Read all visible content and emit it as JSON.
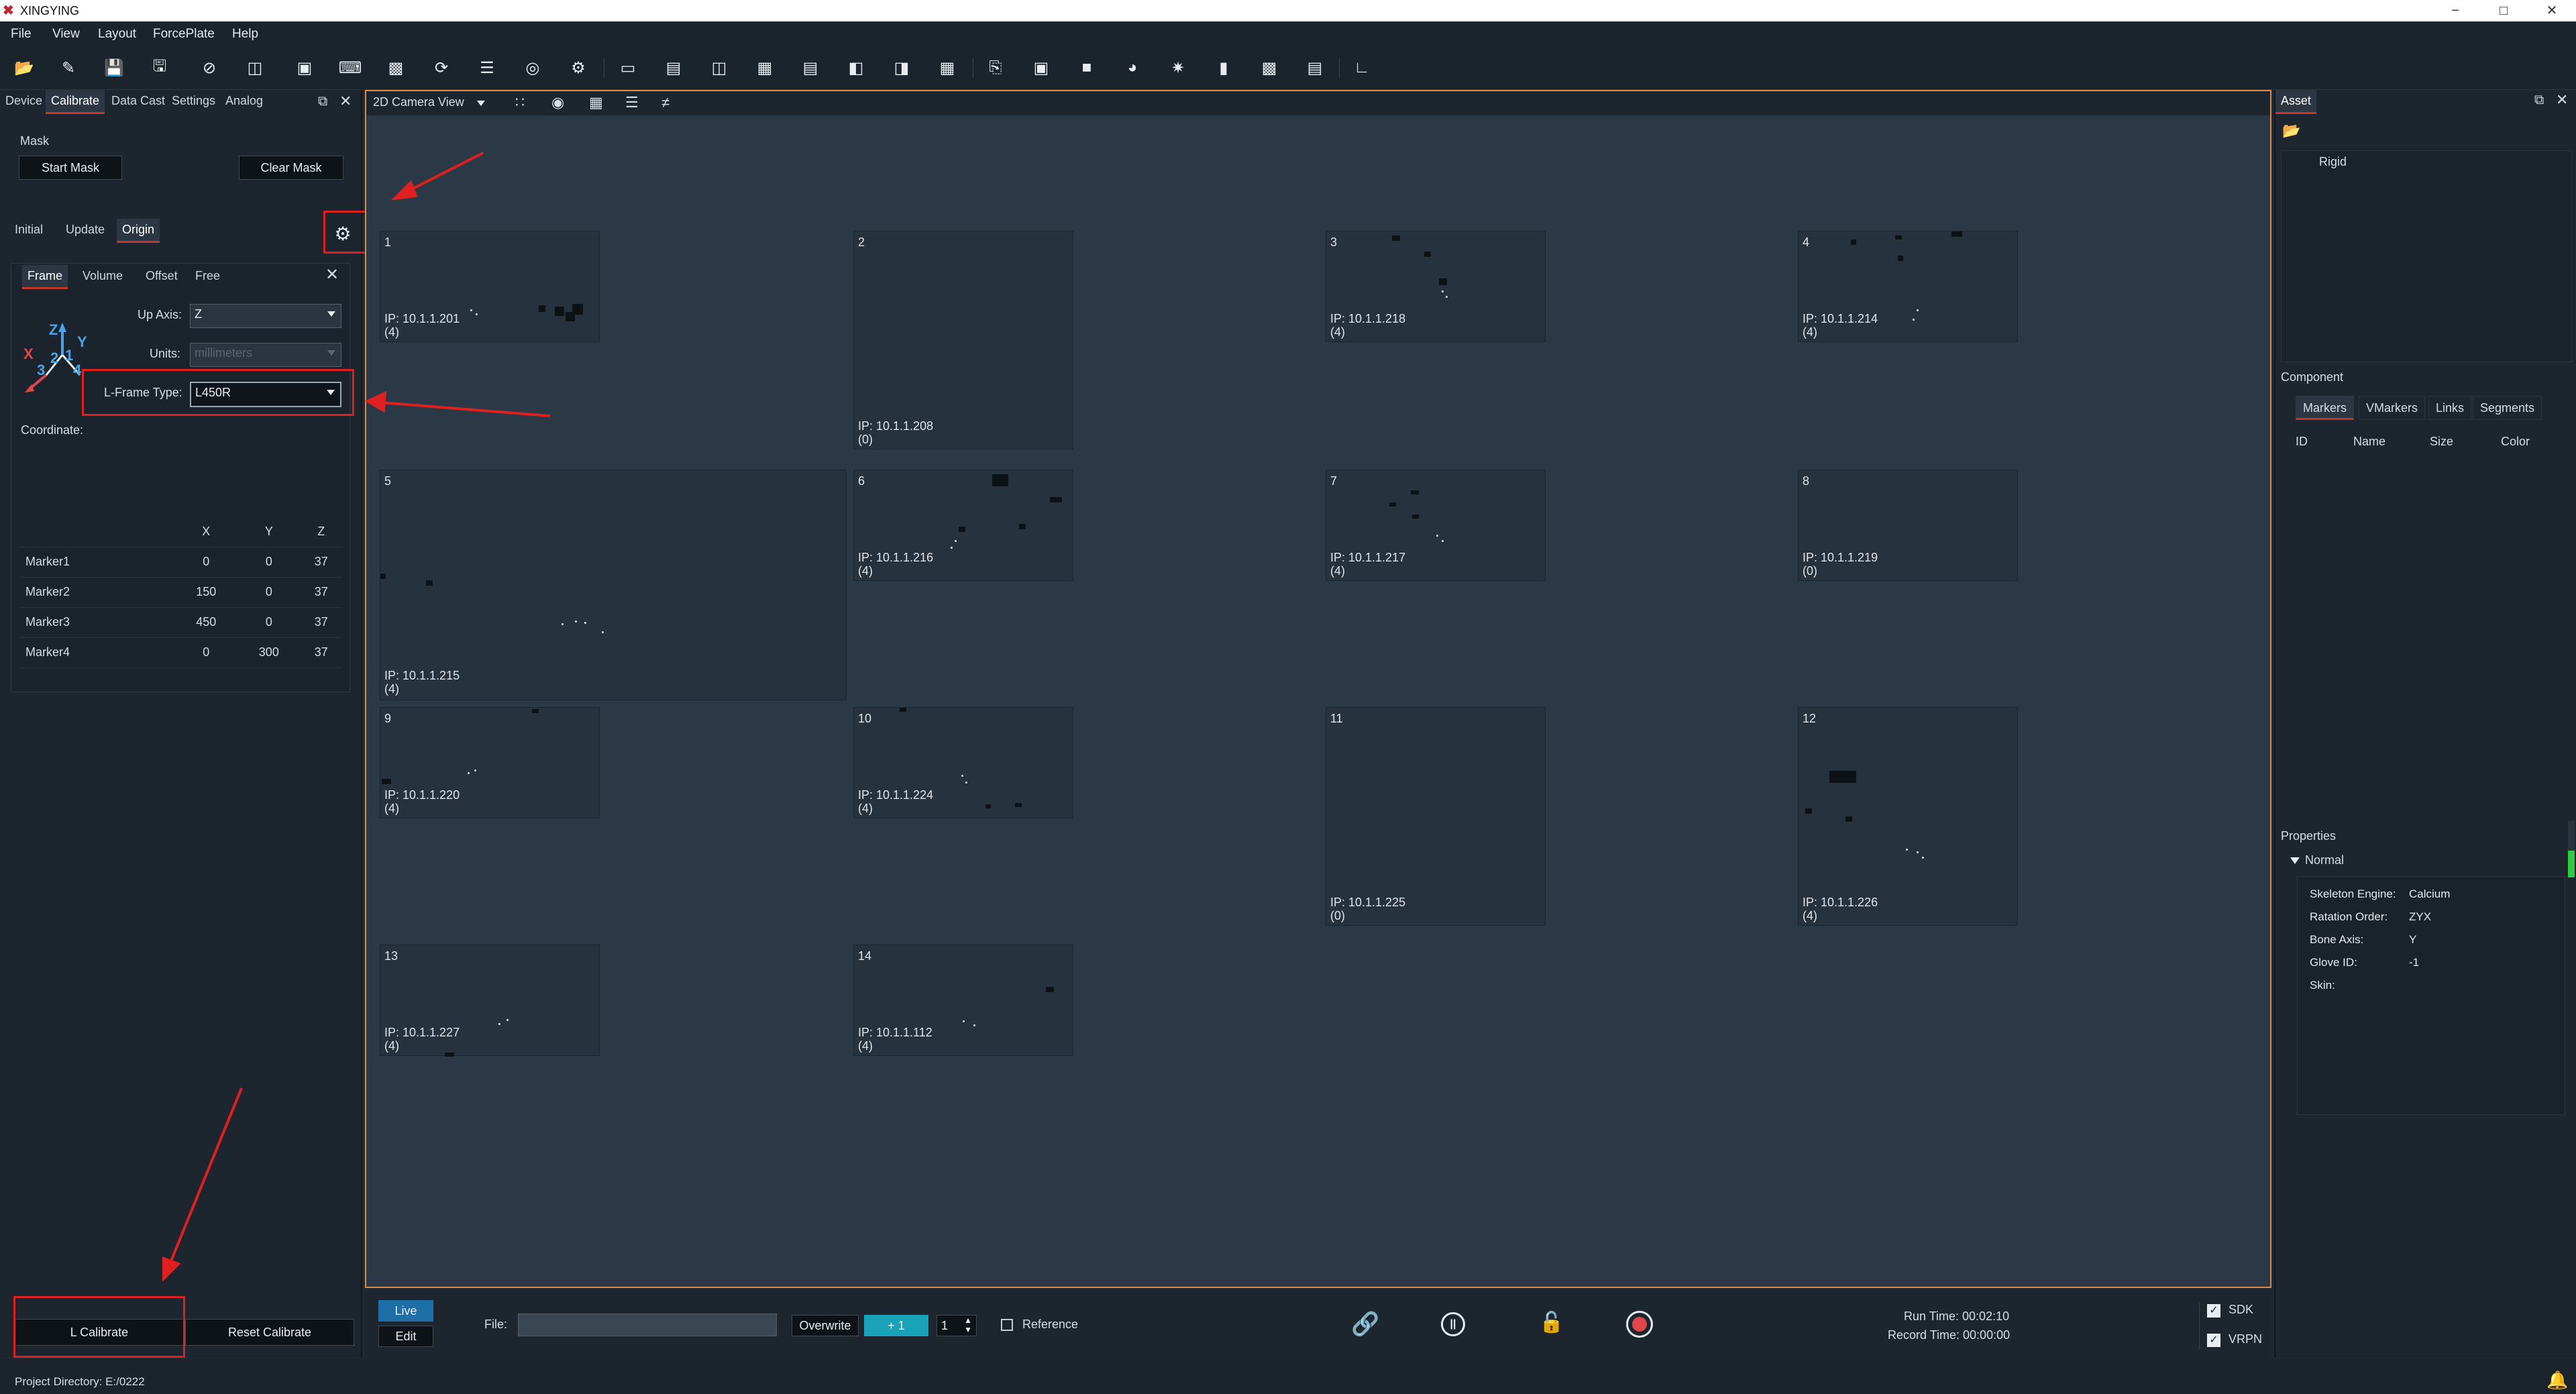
{
  "titlebar": {
    "title": "XINGYING",
    "minimize": "−",
    "maximize": "□",
    "close": "✕"
  },
  "menu": [
    "File",
    "View",
    "Layout",
    "ForcePlate",
    "Help"
  ],
  "left_panel": {
    "tabs": [
      "Device",
      "Calibrate",
      "Data Cast",
      "Settings",
      "Analog"
    ],
    "active_tab": "Calibrate",
    "mask": {
      "title": "Mask",
      "start": "Start Mask",
      "clear": "Clear Mask"
    },
    "subtabs": [
      "Initial",
      "Update",
      "Origin"
    ],
    "active_subtab": "Origin",
    "frame_tabs": [
      "Frame",
      "Volume",
      "Offset",
      "Free"
    ],
    "active_frame_tab": "Frame",
    "up_axis_label": "Up Axis:",
    "up_axis_value": "Z",
    "units_label": "Units:",
    "units_value": "millimeters",
    "lframe_label": "L-Frame Type:",
    "lframe_value": "L450R",
    "coordinate_label": "Coordinate:",
    "axis_glyph": {
      "z": "Z",
      "y": "Y",
      "x": "X",
      "n1": "1",
      "n2": "2",
      "n3": "3",
      "n4": "4"
    },
    "table_headers": [
      "",
      "X",
      "Y",
      "Z"
    ],
    "markers": [
      {
        "name": "Marker1",
        "x": "0",
        "y": "0",
        "z": "37"
      },
      {
        "name": "Marker2",
        "x": "150",
        "y": "0",
        "z": "37"
      },
      {
        "name": "Marker3",
        "x": "450",
        "y": "0",
        "z": "37"
      },
      {
        "name": "Marker4",
        "x": "0",
        "y": "300",
        "z": "37"
      }
    ],
    "l_calibrate": "L Calibrate",
    "reset_calibrate": "Reset Calibrate"
  },
  "viewport": {
    "view_select": "2D Camera View",
    "cameras": [
      {
        "num": "1",
        "ip": "IP: 10.1.1.201",
        "count": "(4)"
      },
      {
        "num": "2",
        "ip": "IP: 10.1.1.208",
        "count": "(0)"
      },
      {
        "num": "3",
        "ip": "IP: 10.1.1.218",
        "count": "(4)"
      },
      {
        "num": "4",
        "ip": "IP: 10.1.1.214",
        "count": "(4)"
      },
      {
        "num": "5",
        "ip": "IP: 10.1.1.215",
        "count": "(4)"
      },
      {
        "num": "6",
        "ip": "IP: 10.1.1.216",
        "count": "(4)"
      },
      {
        "num": "7",
        "ip": "IP: 10.1.1.217",
        "count": "(4)"
      },
      {
        "num": "8",
        "ip": "IP: 10.1.1.219",
        "count": "(0)"
      },
      {
        "num": "9",
        "ip": "IP: 10.1.1.220",
        "count": "(4)"
      },
      {
        "num": "10",
        "ip": "IP: 10.1.1.224",
        "count": "(4)"
      },
      {
        "num": "11",
        "ip": "IP: 10.1.1.225",
        "count": "(0)"
      },
      {
        "num": "12",
        "ip": "IP: 10.1.1.226",
        "count": "(4)"
      },
      {
        "num": "13",
        "ip": "IP: 10.1.1.227",
        "count": "(4)"
      },
      {
        "num": "14",
        "ip": "IP: 10.1.1.112",
        "count": "(4)"
      }
    ]
  },
  "right_panel": {
    "asset_tab": "Asset",
    "rigid_label": "Rigid",
    "component_title": "Component",
    "component_tabs": [
      "Markers",
      "VMarkers",
      "Links",
      "Segments"
    ],
    "active_component_tab": "Markers",
    "columns": [
      "ID",
      "Name",
      "Size",
      "Color"
    ],
    "properties_title": "Properties",
    "normal_label": "Normal",
    "properties": [
      {
        "key": "Skeleton Engine:",
        "value": "Calcium"
      },
      {
        "key": "Ratation Order:",
        "value": "ZYX"
      },
      {
        "key": "Bone Axis:",
        "value": "Y"
      },
      {
        "key": "Glove ID:",
        "value": "-1"
      },
      {
        "key": "Skin:",
        "value": ""
      }
    ]
  },
  "transport": {
    "live": "Live",
    "edit": "Edit",
    "file_label": "File:",
    "file_value": "",
    "overwrite": "Overwrite",
    "plus_one": "+ 1",
    "spin_value": "1",
    "reference_label": "Reference",
    "run_time": "Run Time:  00:02:10",
    "record_time": "Record Time:  00:00:00",
    "sdk": "SDK",
    "vrpn": "VRPN"
  },
  "status": {
    "project_dir": "Project Directory:   E:/0222"
  },
  "colors": {
    "accent_red": "#c0392b",
    "highlight_red": "#e02020",
    "viewport_border": "#d98b47",
    "live_blue": "#1e6fa8",
    "plus_cyan": "#1aa3b8"
  }
}
